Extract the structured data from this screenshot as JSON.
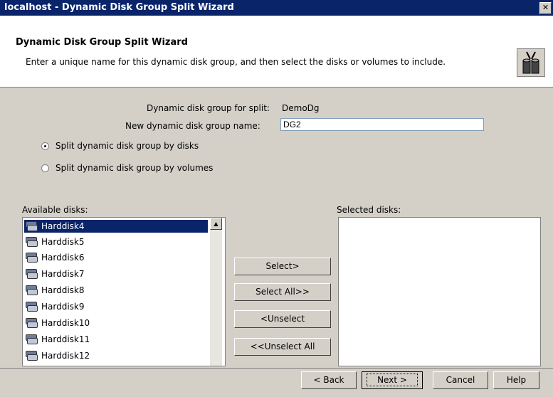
{
  "window": {
    "title": "localhost - Dynamic Disk Group Split Wizard",
    "close": "✕"
  },
  "header": {
    "title": "Dynamic Disk Group Split Wizard",
    "subtitle": "Enter a unique name for this dynamic disk group, and then select the disks or volumes to include.",
    "icon": "wizard-disks-icon"
  },
  "form": {
    "split_group_label": "Dynamic disk group for split:",
    "split_group_value": "DemoDg",
    "new_name_label": "New dynamic disk group name:",
    "new_name_value": "DG2",
    "radio_disks_label": "Split dynamic disk group by disks",
    "radio_volumes_label": "Split dynamic disk group by volumes",
    "radio_selected": "disks"
  },
  "available": {
    "label": "Available disks:",
    "items": [
      "Harddisk4",
      "Harddisk5",
      "Harddisk6",
      "Harddisk7",
      "Harddisk8",
      "Harddisk9",
      "Harddisk10",
      "Harddisk11",
      "Harddisk12"
    ],
    "selected_index": 0
  },
  "selected": {
    "label": "Selected disks:",
    "items": []
  },
  "buttons": {
    "select": "Select>",
    "select_all": "Select All>>",
    "unselect": "<Unselect",
    "unselect_all": "<<Unselect All",
    "back": "< Back",
    "next": "Next >",
    "cancel": "Cancel",
    "help": "Help"
  }
}
